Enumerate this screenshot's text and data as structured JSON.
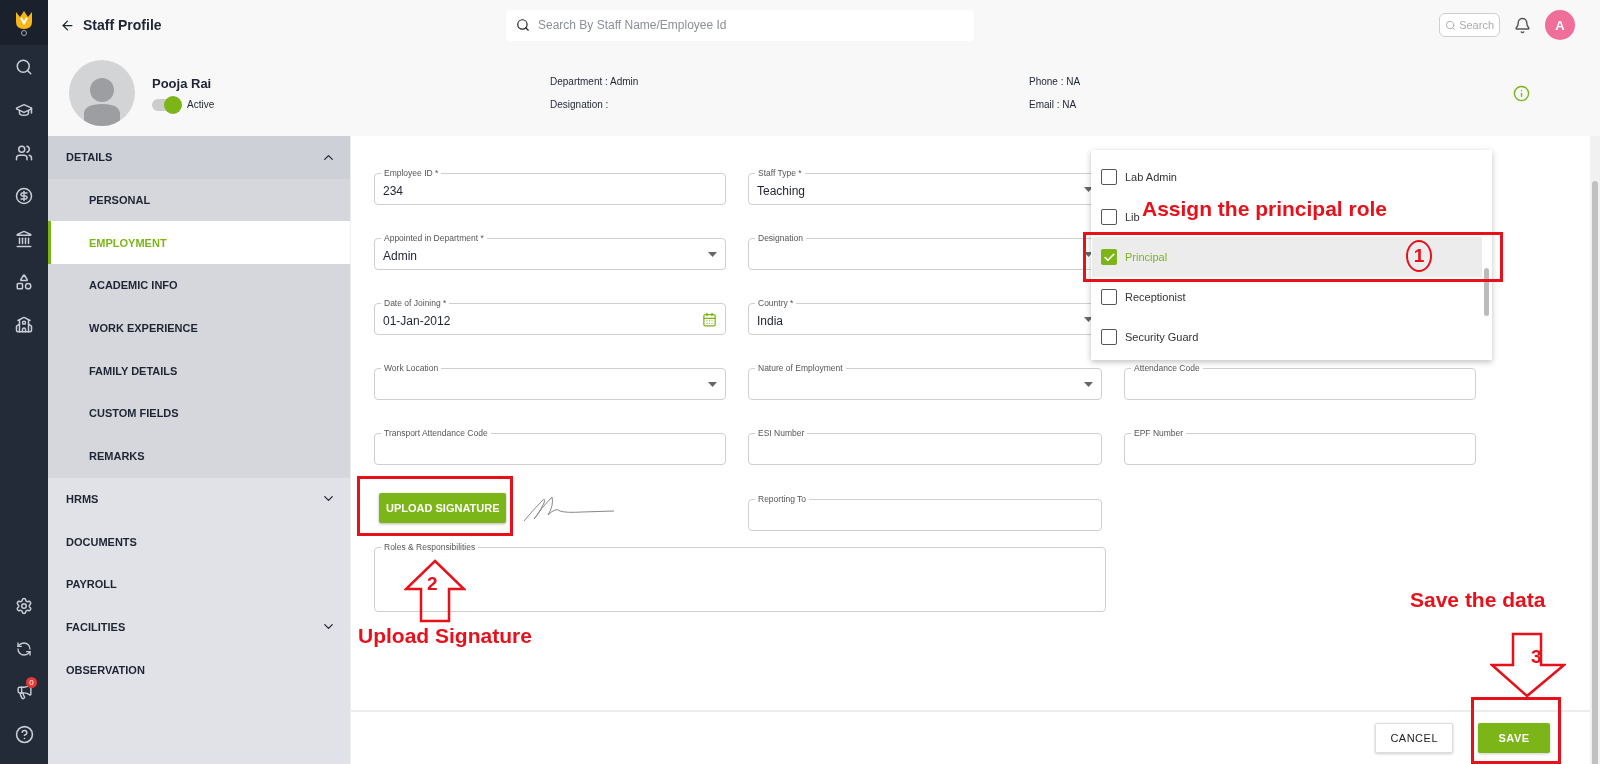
{
  "rail": {
    "notification_badge": "0"
  },
  "header": {
    "title": "Staff Profile",
    "search": {
      "placeholder": "Search By Staff Name/Employee Id"
    },
    "search_button": "Search",
    "avatar": "A"
  },
  "profile": {
    "name": "Pooja Rai",
    "active": true,
    "status": "Active",
    "details": [
      "Department : Admin",
      "Designation :",
      "Phone : NA",
      "Email : NA"
    ]
  },
  "sidebar": {
    "items": [
      {
        "label": "DETAILS",
        "kind": "group",
        "expanded": true,
        "children": [
          {
            "label": "PERSONAL",
            "selected": false
          },
          {
            "label": "EMPLOYMENT",
            "selected": true
          },
          {
            "label": "ACADEMIC INFO",
            "selected": false
          },
          {
            "label": "WORK EXPERIENCE",
            "selected": false
          },
          {
            "label": "FAMILY DETAILS",
            "selected": false
          },
          {
            "label": "CUSTOM FIELDS",
            "selected": false
          },
          {
            "label": "REMARKS",
            "selected": false
          }
        ]
      },
      {
        "label": "HRMS",
        "kind": "group",
        "expanded": false
      },
      {
        "label": "DOCUMENTS",
        "kind": "link"
      },
      {
        "label": "PAYROLL",
        "kind": "link"
      },
      {
        "label": "FACILITIES",
        "kind": "group",
        "expanded": false
      },
      {
        "label": "OBSERVATION",
        "kind": "link"
      }
    ]
  },
  "form": {
    "rows": [
      [
        {
          "label": "Employee ID *",
          "value": "234",
          "kind": "text"
        },
        {
          "label": "Staff Type *",
          "value": "Teaching",
          "kind": "select"
        }
      ],
      [
        {
          "label": "Appointed in Department *",
          "value": "Admin",
          "kind": "select"
        },
        {
          "label": "Designation",
          "kind": "select"
        }
      ],
      [
        {
          "label": "Date of Joining *",
          "value": "01-Jan-2012",
          "kind": "date"
        },
        {
          "label": "Country *",
          "value": "India",
          "kind": "select"
        }
      ],
      [
        {
          "label": "Work Location",
          "kind": "select"
        },
        {
          "label": "Nature of Employment",
          "kind": "select"
        },
        {
          "label": "Attendance Code",
          "kind": "text"
        }
      ],
      [
        {
          "label": "Transport Attendance Code",
          "kind": "text"
        },
        {
          "label": "ESI Number",
          "kind": "text"
        },
        {
          "label": "EPF Number",
          "kind": "text"
        }
      ]
    ],
    "upload_button": "UPLOAD SIGNATURE",
    "reporting_to": {
      "label": "Reporting To"
    },
    "roles": {
      "label": "Roles & Responsibilities"
    }
  },
  "role_dropdown": {
    "options": [
      {
        "label": "Lab Admin",
        "checked": false
      },
      {
        "label": "Lib",
        "checked": false
      },
      {
        "label": "Principal",
        "checked": true
      },
      {
        "label": "Receptionist",
        "checked": false
      },
      {
        "label": "Security Guard",
        "checked": false
      }
    ]
  },
  "footer": {
    "buttons": [
      {
        "label": "CANCEL",
        "kind": "secondary"
      },
      {
        "label": "SAVE",
        "kind": "primary"
      }
    ]
  },
  "annotations": [
    {
      "number": "1",
      "caption": "Assign the principal role"
    },
    {
      "number": "2",
      "caption": "Upload Signature"
    },
    {
      "number": "3",
      "caption": "Save the data"
    }
  ]
}
